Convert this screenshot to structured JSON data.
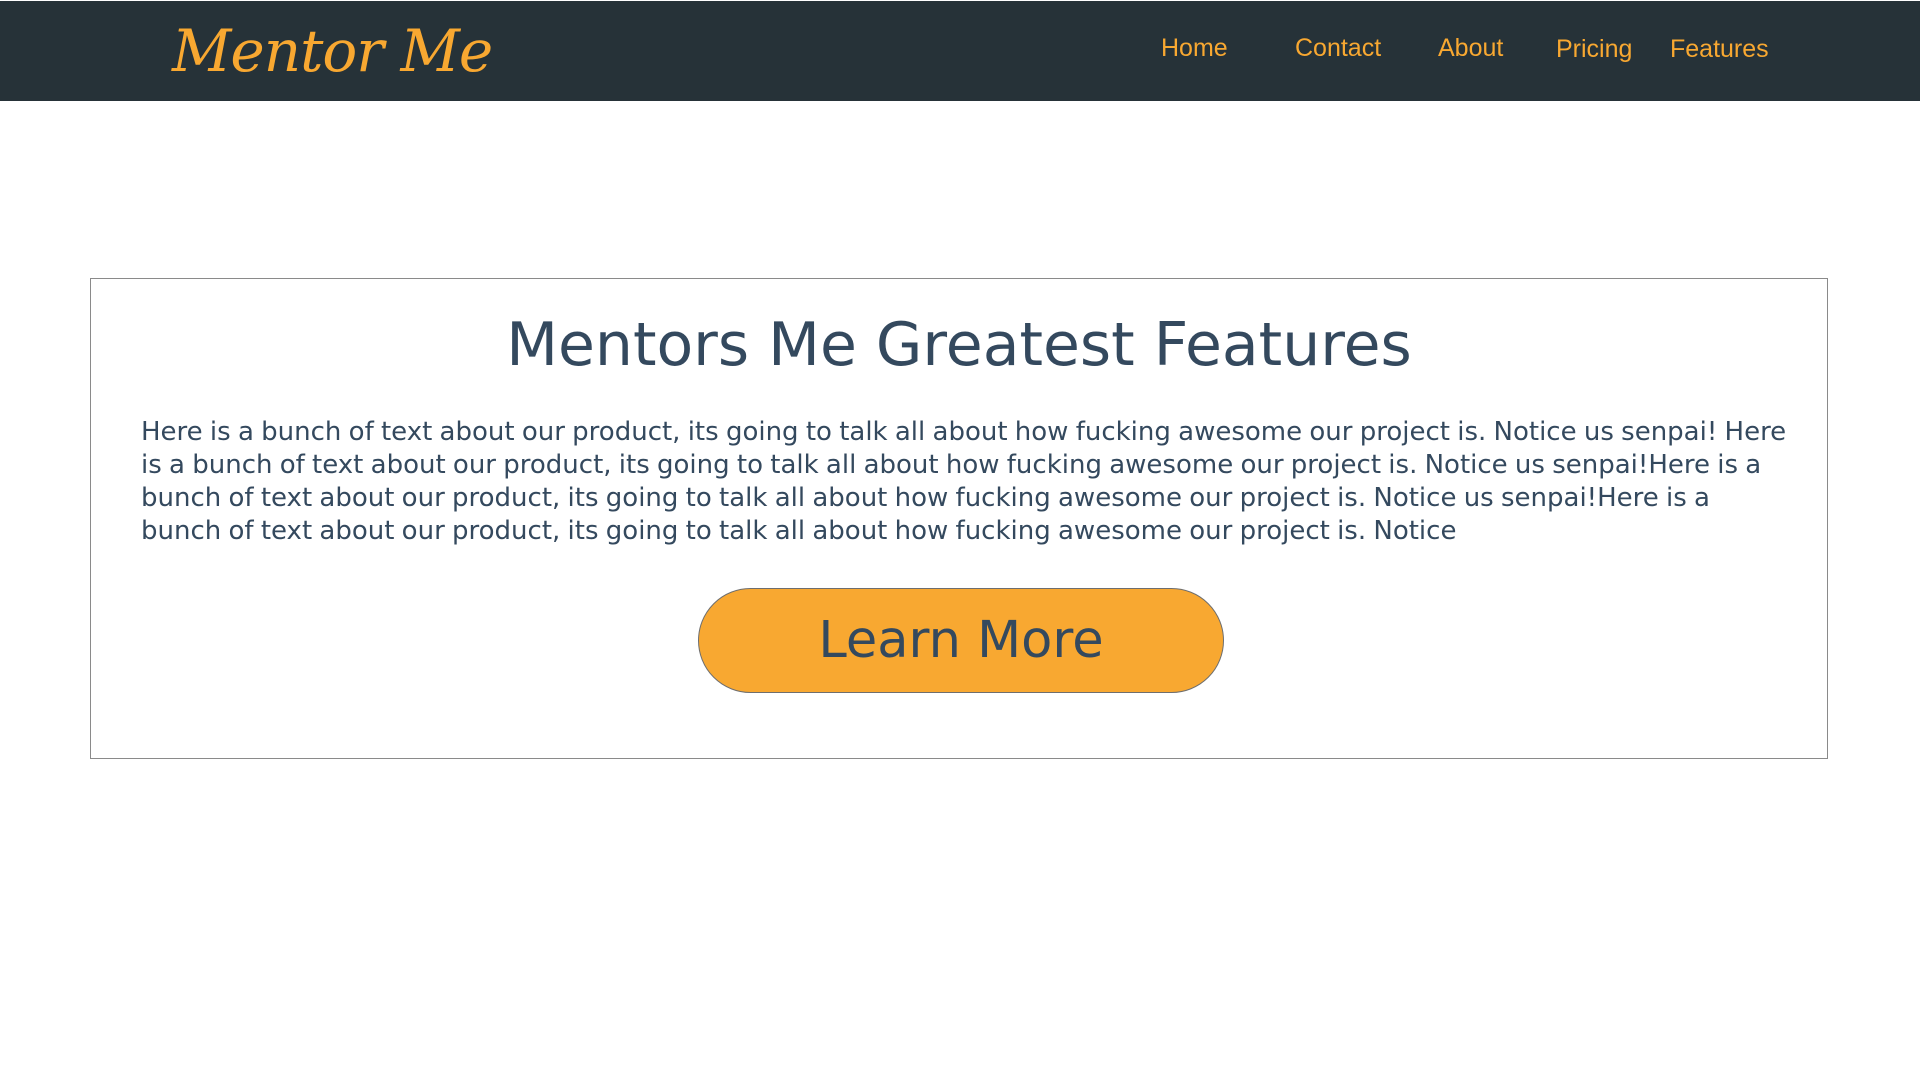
{
  "header": {
    "brand": "Mentor Me",
    "nav": {
      "home": "Home",
      "contact": "Contact",
      "about": "About",
      "pricing": "Pricing",
      "features": "Features"
    }
  },
  "main": {
    "title": "Mentors Me Greatest Features",
    "body": "Here is a bunch of text about our product, its going to talk all about how fucking awesome our project is. Notice us senpai! Here is a bunch of text about our product, its going to talk all about how fucking awesome our project is. Notice us senpai!Here is a bunch of text about our product, its going to talk all about how fucking awesome our project is. Notice us senpai!Here is a bunch of text about our product, its going to talk all about how fucking awesome our project is. Notice",
    "cta_label": "Learn More"
  },
  "colors": {
    "navbar_bg": "#263238",
    "accent": "#f8a831",
    "text": "#34495e",
    "card_border": "#8a8a8a"
  }
}
